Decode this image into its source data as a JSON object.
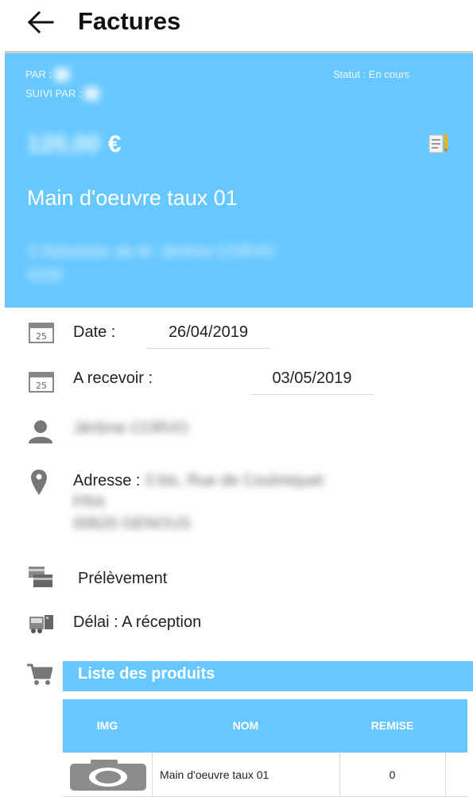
{
  "appbar": {
    "title": "Factures",
    "back_icon": "arrow-left-icon"
  },
  "header": {
    "by_label": "PAR :",
    "by_value": "██",
    "followed_label": "SUIVI PAR :",
    "followed_value": "██",
    "status": "Statut : En cours",
    "amount": "120,00",
    "currency": "€",
    "title": "Main d'oeuvre taux 01",
    "address_line1": "3 Sebastien de M. Jérôme CORVO",
    "address_line2": "4200",
    "color": "#67c8ff"
  },
  "details": {
    "date_label": "Date :",
    "date_value": "26/04/2019",
    "due_label": "A recevoir :",
    "due_value": "03/05/2019",
    "calendar_day": "25",
    "customer_name": "Jérôme CORVO",
    "address_label": "Adresse :",
    "address_line1": "3 bis, Rue de Coulmiquet",
    "address_line2": "FRA",
    "address_line3": "00620 GENOUS",
    "payment_method": "Prélèvement",
    "delay": "Délai : A réception"
  },
  "products": {
    "title": "Liste des produits",
    "columns": [
      "IMG",
      "NOM",
      "REMISE"
    ],
    "rows": [
      {
        "name": "Main d'oeuvre taux 01",
        "discount": "0"
      }
    ]
  }
}
